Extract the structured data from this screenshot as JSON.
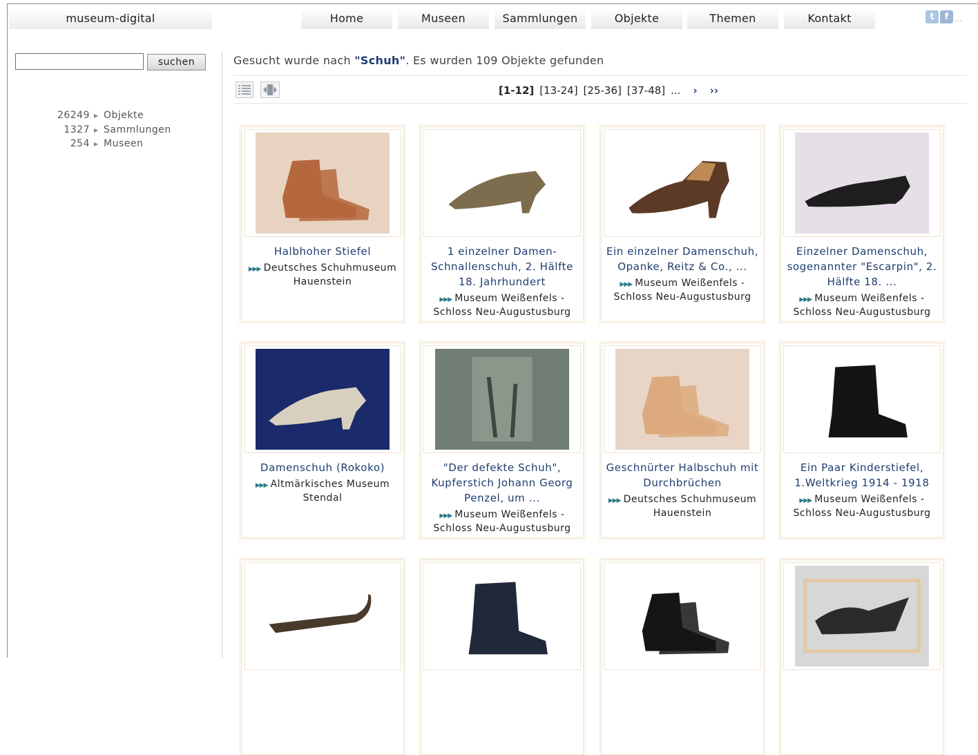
{
  "site": {
    "name": "museum-digital"
  },
  "nav": [
    {
      "label": "Home"
    },
    {
      "label": "Museen"
    },
    {
      "label": "Sammlungen"
    },
    {
      "label": "Objekte"
    },
    {
      "label": "Themen"
    },
    {
      "label": "Kontakt"
    }
  ],
  "social": {
    "twitter_glyph": "t",
    "facebook_glyph": "f",
    "more_glyph": "..."
  },
  "search": {
    "value": "",
    "button_label": "suchen"
  },
  "stats": [
    {
      "count": "26249",
      "label": "Objekte"
    },
    {
      "count": "1327",
      "label": "Sammlungen"
    },
    {
      "count": "254",
      "label": "Museen"
    }
  ],
  "results": {
    "prefix": "Gesucht wurde nach ",
    "term": "\"Schuh\"",
    "suffix": ". Es wurden 109 Objekte gefunden"
  },
  "pagination": {
    "pages": [
      "[1-12]",
      "[13-24]",
      "[25-36]",
      "[37-48]"
    ],
    "current_index": 0,
    "ellipsis": "...",
    "next": "›",
    "last": "››"
  },
  "objects": [
    {
      "title": "Halbhoher Stiefel",
      "museum": "Deutsches Schuhmuseum Hauenstein",
      "photo_bg": "#e8d3c0",
      "photo_fg": "#b5673e",
      "photo_kind": "boots"
    },
    {
      "title": "1 einzelner Damen-Schnallenschuh, 2. Hälfte 18. Jahrhundert",
      "museum": "Museum Weißenfels - Schloss Neu-Augustusburg",
      "photo_bg": "#ffffff",
      "photo_fg": "#7d6c4e",
      "photo_kind": "heel"
    },
    {
      "title": "Ein einzelner Damenschuh, Opanke, Reitz & Co., ...",
      "museum": "Museum Weißenfels - Schloss Neu-Augustusburg",
      "photo_bg": "#ffffff",
      "photo_fg": "#5b3a26",
      "photo_kind": "pump"
    },
    {
      "title": "Einzelner Damenschuh, sogenannter \"Escarpin\", 2. Hälfte 18. ...",
      "museum": "Museum Weißenfels - Schloss Neu-Augustusburg",
      "photo_bg": "#e7dfe8",
      "photo_fg": "#1e1e1e",
      "photo_kind": "slipper"
    },
    {
      "title": "Damenschuh (Rokoko)",
      "museum": "Altmärkisches Museum Stendal",
      "photo_bg": "#1a2a6b",
      "photo_fg": "#d8d0bf",
      "photo_kind": "heel"
    },
    {
      "title": "\"Der defekte Schuh\", Kupferstich Johann Georg Penzel, um ...",
      "museum": "Museum Weißenfels - Schloss Neu-Augustusburg",
      "photo_bg": "#6f7d72",
      "photo_fg": "#3e463f",
      "photo_kind": "print"
    },
    {
      "title": "Geschnürter Halbschuh mit Durchbrüchen",
      "museum": "Deutsches Schuhmuseum Hauenstein",
      "photo_bg": "#e8d5c6",
      "photo_fg": "#dcaa7e",
      "photo_kind": "boots"
    },
    {
      "title": "Ein Paar Kinderstiefel, 1.Weltkrieg 1914 - 1918",
      "museum": "Museum Weißenfels - Schloss Neu-Augustusburg",
      "photo_bg": "#ffffff",
      "photo_fg": "#141414",
      "photo_kind": "boot"
    },
    {
      "title": "",
      "museum": "",
      "photo_bg": "#ffffff",
      "photo_fg": "#4a3a2c",
      "photo_kind": "skate"
    },
    {
      "title": "",
      "museum": "",
      "photo_bg": "#ffffff",
      "photo_fg": "#20283a",
      "photo_kind": "boot"
    },
    {
      "title": "",
      "museum": "",
      "photo_bg": "#ffffff",
      "photo_fg": "#151515",
      "photo_kind": "boots"
    },
    {
      "title": "",
      "museum": "",
      "photo_bg": "#d6d7d6",
      "photo_fg": "#2b2b2b",
      "photo_kind": "fragment"
    }
  ]
}
